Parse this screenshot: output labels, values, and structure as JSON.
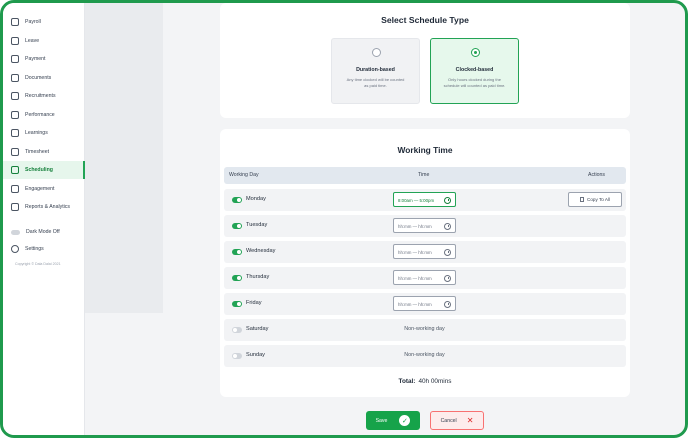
{
  "sidebar": {
    "items": [
      {
        "label": "Payroll",
        "icon": "payroll-icon"
      },
      {
        "label": "Leave",
        "icon": "leave-icon"
      },
      {
        "label": "Payment",
        "icon": "payment-icon"
      },
      {
        "label": "Documents",
        "icon": "documents-icon"
      },
      {
        "label": "Recruitments",
        "icon": "recruitments-icon"
      },
      {
        "label": "Performance",
        "icon": "performance-icon"
      },
      {
        "label": "Learnings",
        "icon": "learnings-icon"
      },
      {
        "label": "Timesheet",
        "icon": "timesheet-icon"
      },
      {
        "label": "Scheduling",
        "icon": "calendar-icon",
        "active": true
      },
      {
        "label": "Engagement",
        "icon": "engagement-icon"
      },
      {
        "label": "Reports & Analytics",
        "icon": "reports-icon"
      }
    ],
    "dark_mode_label": "Dark Mode Off",
    "settings_label": "Settings",
    "copyright": "Copyright © Dala Dalai 2021"
  },
  "schedule_type": {
    "title": "Select Schedule Type",
    "options": [
      {
        "title": "Duration-based",
        "description": "Any time clocked will be counted as paid time.",
        "selected": false
      },
      {
        "title": "Clocked-based",
        "description": "Only hours clocked during the schedule will counted as paid time.",
        "selected": true
      }
    ]
  },
  "working_time": {
    "title": "Working Time",
    "columns": {
      "day": "Working Day",
      "time": "Time",
      "actions": "Actions"
    },
    "copy_all_label": "Copy To All",
    "days": [
      {
        "day": "Monday",
        "on": true,
        "time_start": "8:00am",
        "time_end": "5:00pm"
      },
      {
        "day": "Tuesday",
        "on": true,
        "time_start": "hh:mm",
        "time_end": "hh:mm"
      },
      {
        "day": "Wednesday",
        "on": true,
        "time_start": "hh:mm",
        "time_end": "hh:mm"
      },
      {
        "day": "Thursday",
        "on": true,
        "time_start": "hh:mm",
        "time_end": "hh:mm"
      },
      {
        "day": "Friday",
        "on": true,
        "time_start": "hh:mm",
        "time_end": "hh:mm"
      },
      {
        "day": "Saturday",
        "on": false,
        "status": "Non-working day"
      },
      {
        "day": "Sunday",
        "on": false,
        "status": "Non-working day"
      }
    ],
    "time_separator": "—",
    "total_label": "Total:",
    "total_value": "40h 00mins"
  },
  "actions": {
    "save_label": "Save",
    "cancel_label": "Cancel"
  },
  "colors": {
    "accent": "#22a355",
    "danger": "#dc2626"
  }
}
